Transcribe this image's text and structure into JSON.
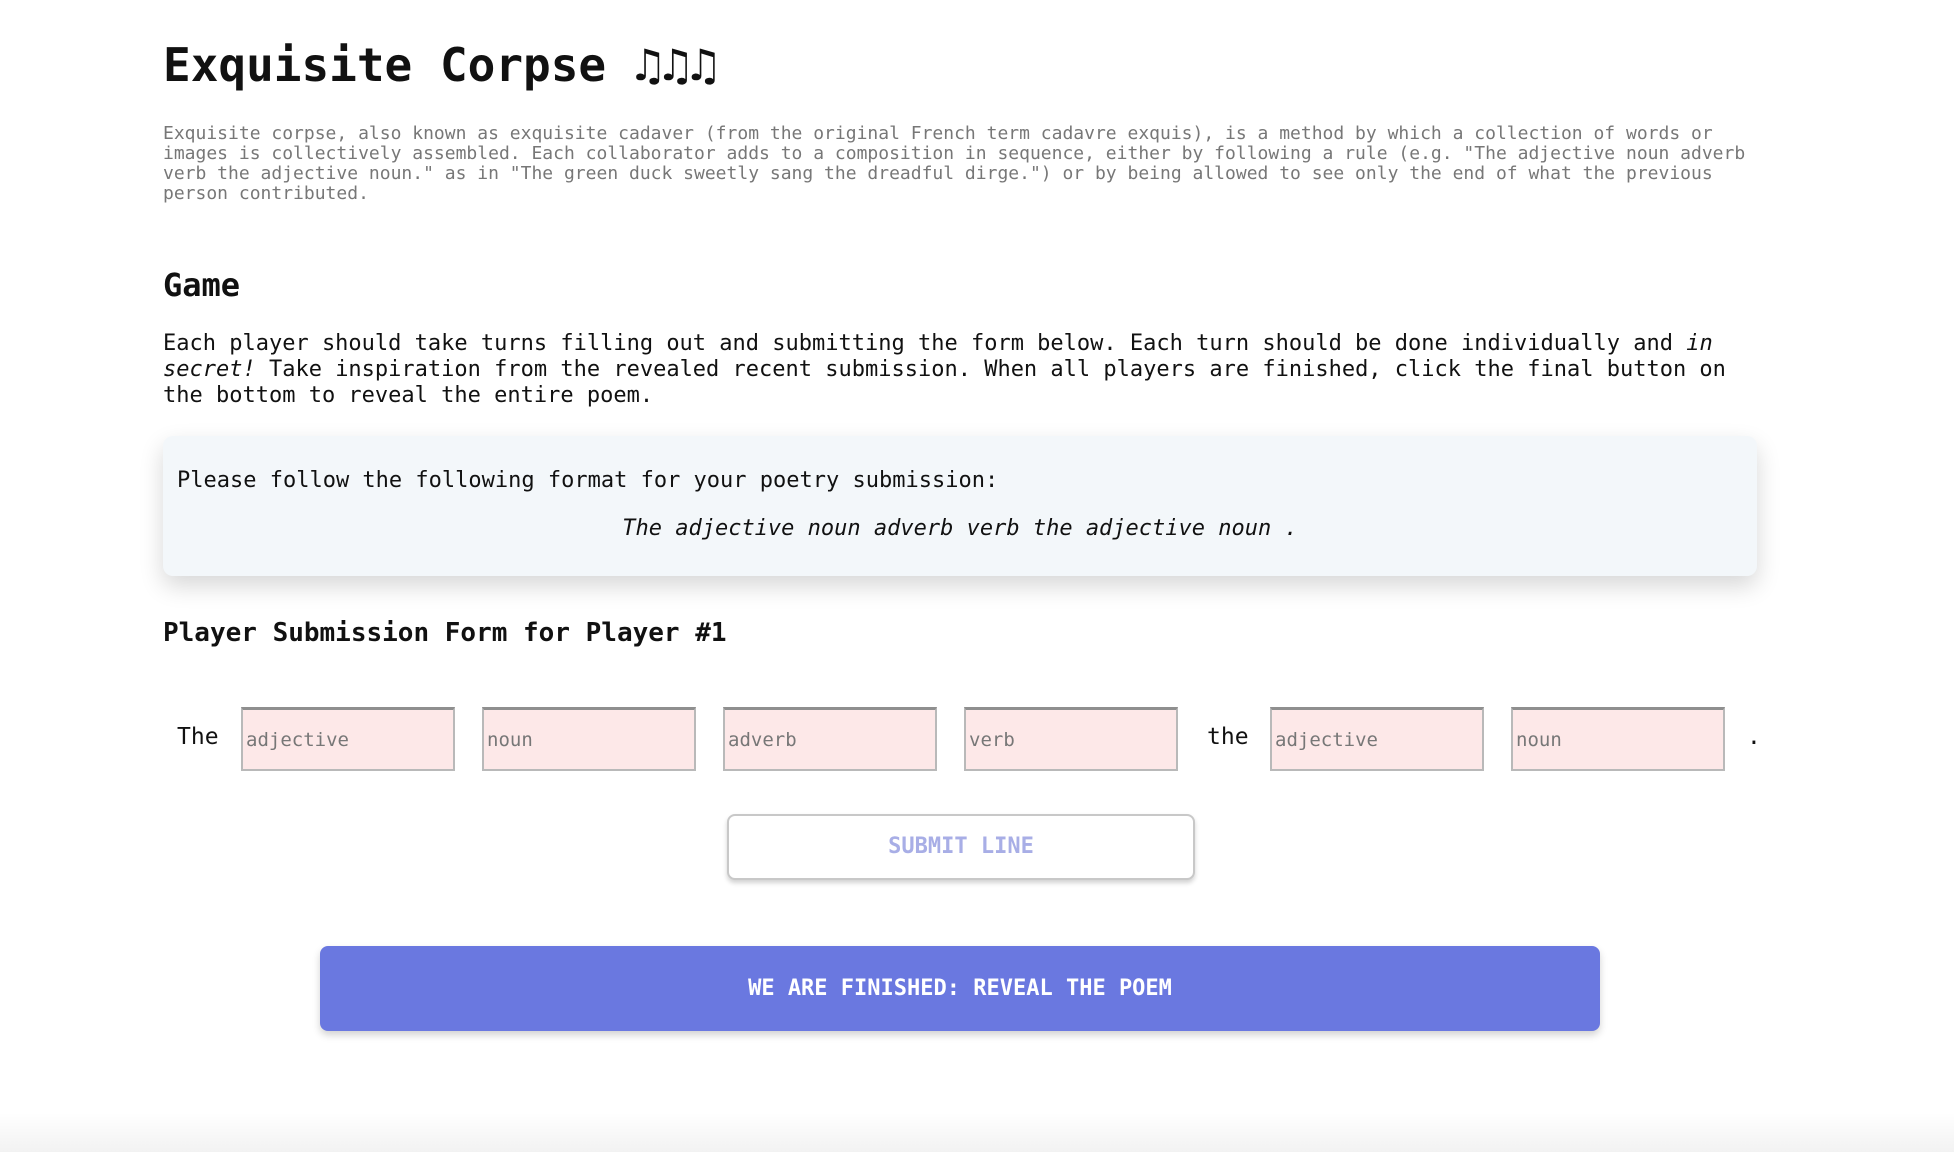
{
  "header": {
    "title": "Exquisite Corpse ♫♫♫",
    "intro": "Exquisite corpse, also known as exquisite cadaver (from the original French term cadavre exquis), is a method by which a collection of words or images is collectively assembled. Each collaborator adds to a composition in sequence, either by following a rule (e.g. \"The adjective noun adverb verb the adjective noun.\" as in \"The green duck sweetly sang the dreadful dirge.\") or by being allowed to see only the end of what the previous person contributed."
  },
  "game": {
    "heading": "Game",
    "instructions_before": "Each player should take turns filling out and submitting the form below. Each turn should be done individually and ",
    "instructions_emphasis": "in secret!",
    "instructions_after": " Take inspiration from the revealed recent submission. When all players are finished, click the final button on the bottom to reveal the entire poem."
  },
  "format_box": {
    "lead": "Please follow the following format for your poetry submission:",
    "pattern": "The adjective noun adverb verb the adjective noun ."
  },
  "form": {
    "heading": "Player Submission Form for Player #1",
    "word_the_start": "The",
    "word_the_mid": "the",
    "word_period": ".",
    "fields": [
      {
        "placeholder": "adjective",
        "value": ""
      },
      {
        "placeholder": "noun",
        "value": ""
      },
      {
        "placeholder": "adverb",
        "value": ""
      },
      {
        "placeholder": "verb",
        "value": ""
      },
      {
        "placeholder": "adjective",
        "value": ""
      },
      {
        "placeholder": "noun",
        "value": ""
      }
    ],
    "submit_label": "SUBMIT LINE"
  },
  "reveal": {
    "label": "WE ARE FINISHED: REVEAL THE POEM"
  },
  "colors": {
    "field_background": "#fde8e8",
    "format_box_background": "#f3f7fa",
    "reveal_button": "#6a78e0",
    "submit_text": "#a8aee6"
  }
}
